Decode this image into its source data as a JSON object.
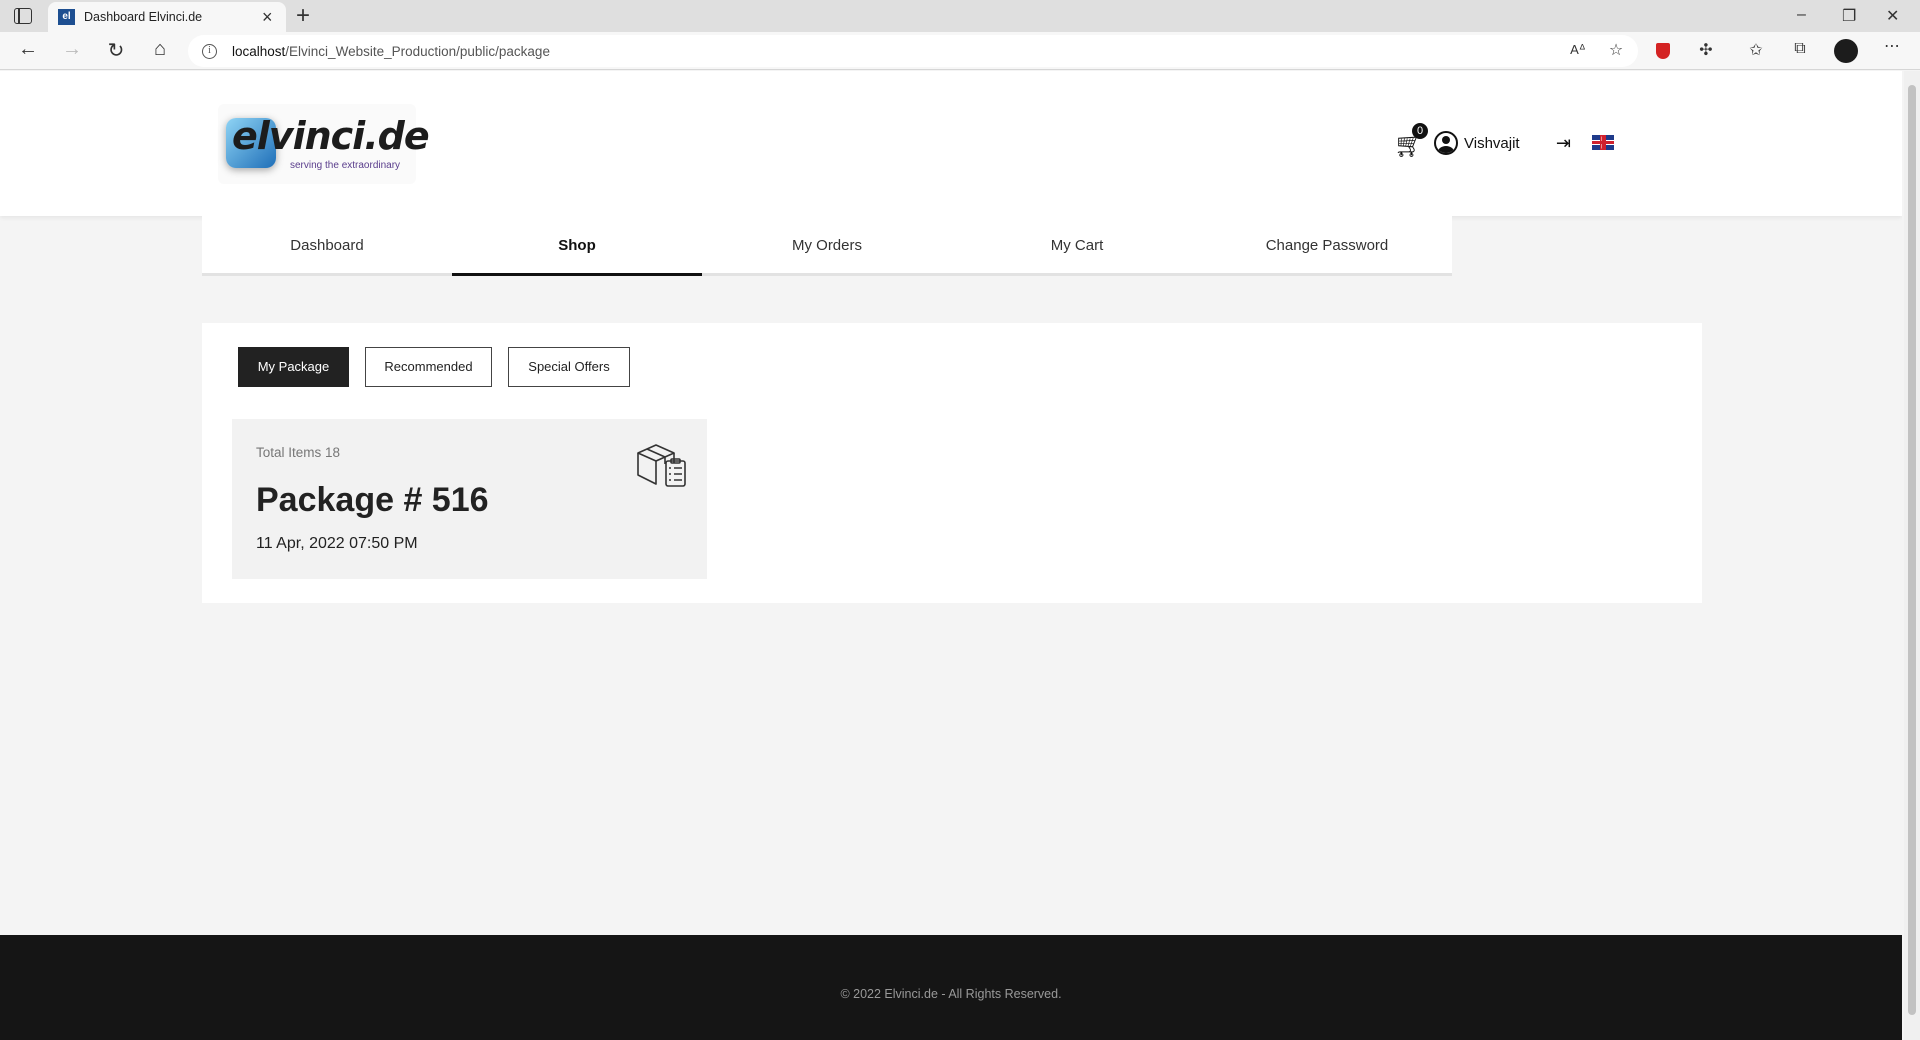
{
  "browser": {
    "tab_title": "Dashboard Elvinci.de",
    "tab_favicon": "el",
    "url_host": "localhost",
    "url_path": "/Elvinci_Website_Production/public/package"
  },
  "header": {
    "logo_text": "elvinci.de",
    "logo_tagline": "serving the extraordinary",
    "cart_count": "0",
    "user_name": "Vishvajit"
  },
  "nav": {
    "tabs": [
      {
        "label": "Dashboard"
      },
      {
        "label": "Shop"
      },
      {
        "label": "My Orders"
      },
      {
        "label": "My Cart"
      },
      {
        "label": "Change Password"
      }
    ],
    "active": "Shop"
  },
  "filters": {
    "my_package": "My Package",
    "recommended": "Recommended",
    "special_offers": "Special Offers",
    "active": "My Package"
  },
  "package": {
    "total_items": "Total Items 18",
    "title": "Package # 516",
    "date": "11 Apr, 2022 07:50 PM"
  },
  "footer": {
    "copyright": "© 2022 Elvinci.de - All Rights Reserved."
  },
  "icons": {
    "cart": "cart-icon",
    "user": "user-icon",
    "logout": "logout-icon",
    "flag": "uk-flag-icon",
    "package": "package-box-icon"
  }
}
